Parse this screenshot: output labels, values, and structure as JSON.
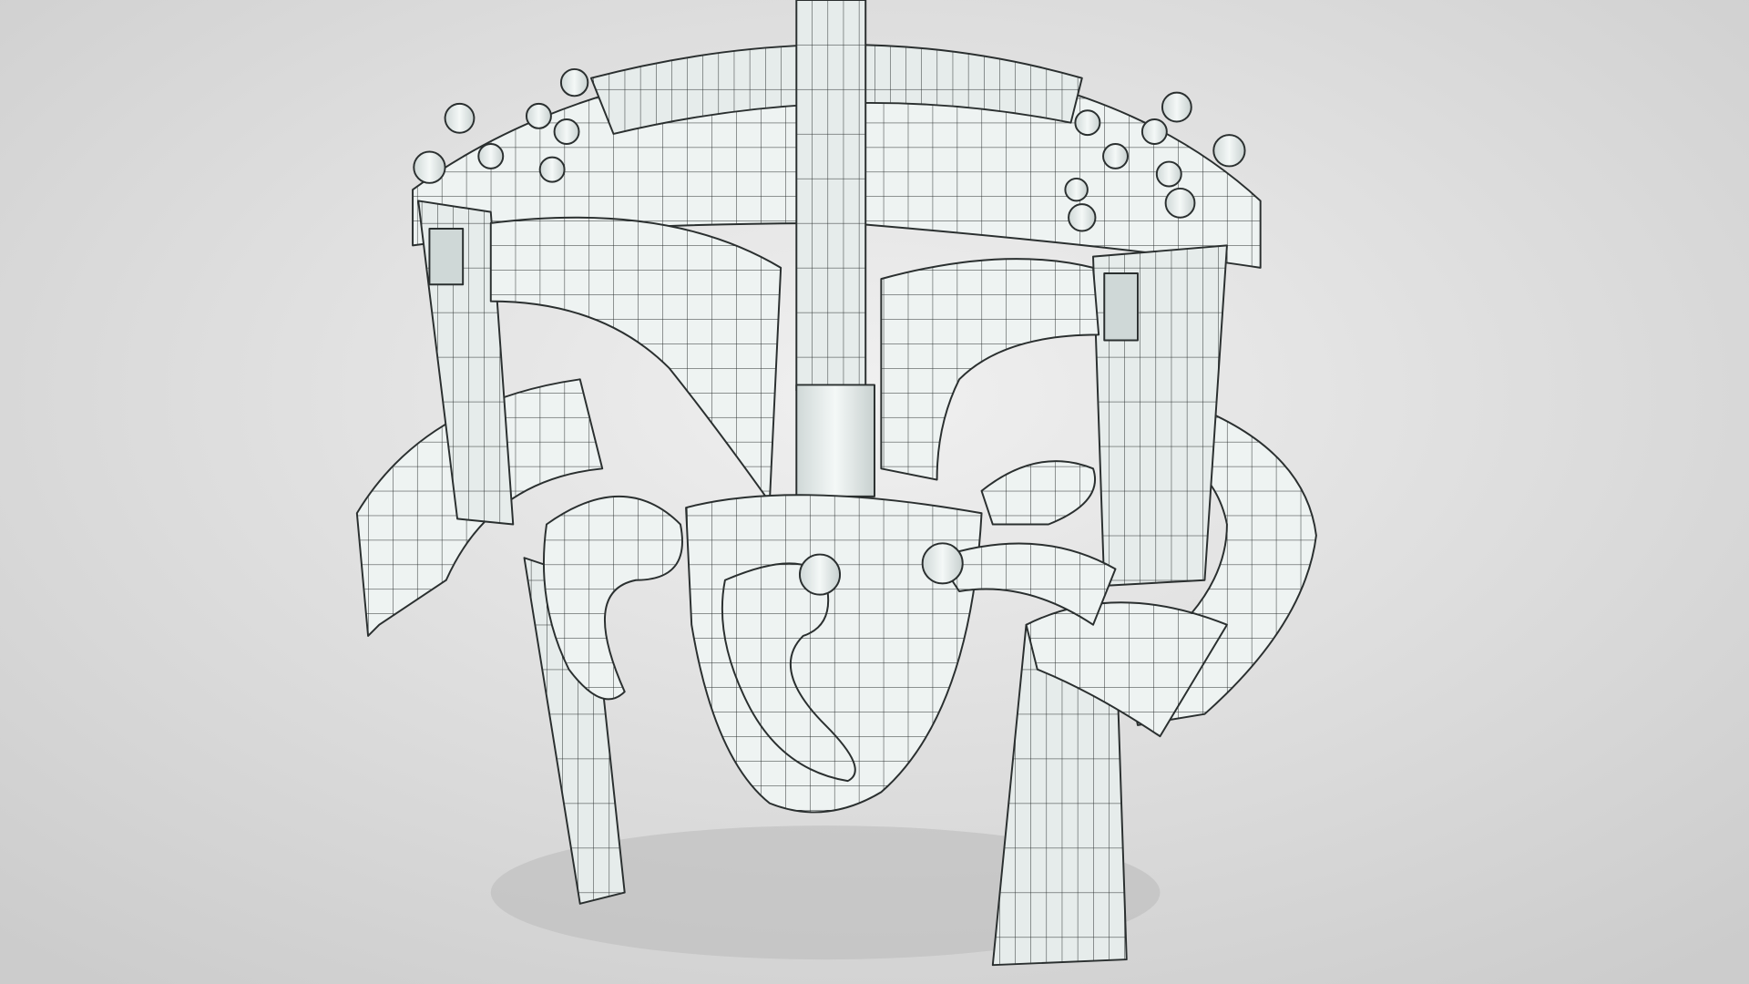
{
  "render": {
    "colors": {
      "background_light": "#ececec",
      "background_dark": "#cfcfcf",
      "surface": "#eef3f2",
      "surface_shade": "#cfd8d7",
      "mesh_line": "#2a2f2f",
      "shadow": "#b9b9b9"
    }
  }
}
